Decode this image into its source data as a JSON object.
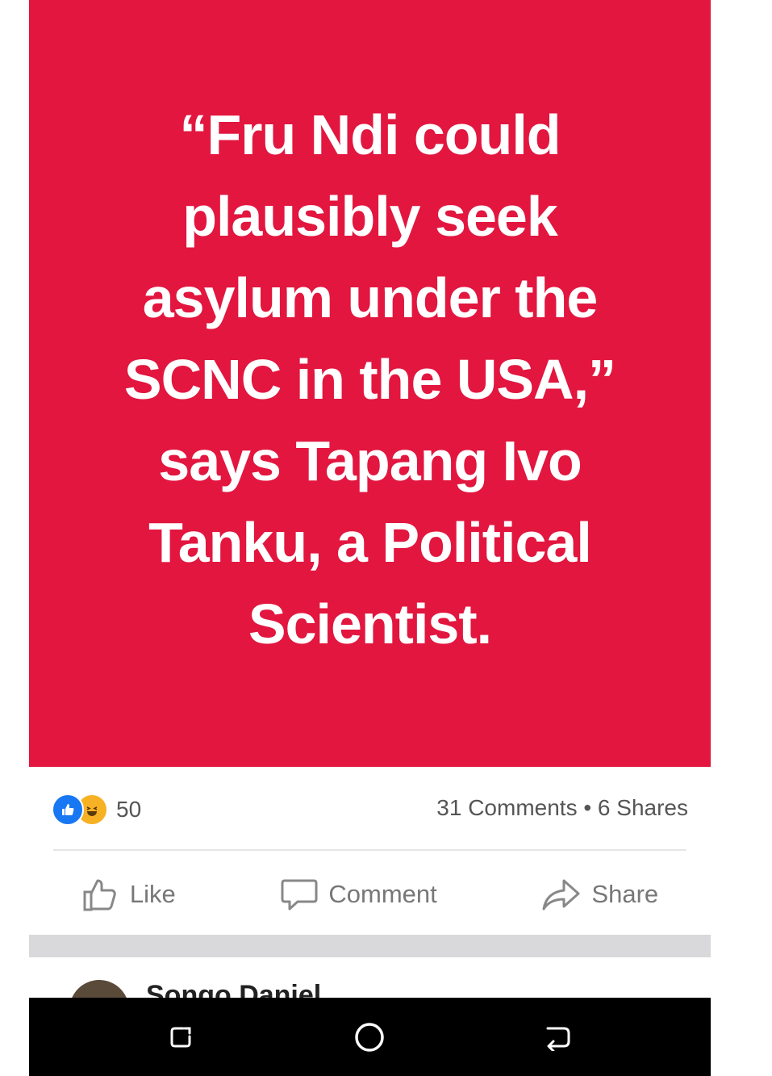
{
  "post": {
    "quote_lines": [
      "“Fru Ndi could",
      "plausibly seek",
      "asylum under the",
      "SCNC in the USA,”",
      "says Tapang Ivo",
      "Tanku, a Political",
      "Scientist."
    ],
    "background_color": "#e2163f"
  },
  "stats": {
    "reaction_icons": [
      "like-icon",
      "haha-icon"
    ],
    "reaction_count": "50",
    "comments_shares": "31 Comments • 6 Shares"
  },
  "actions": {
    "like_label": "Like",
    "comment_label": "Comment",
    "share_label": "Share"
  },
  "next_post": {
    "author": "Songo Daniel",
    "more_icon": "more-dots-icon"
  },
  "nav_bar": {
    "icons": [
      "recent-apps-icon",
      "home-icon",
      "back-icon"
    ]
  }
}
